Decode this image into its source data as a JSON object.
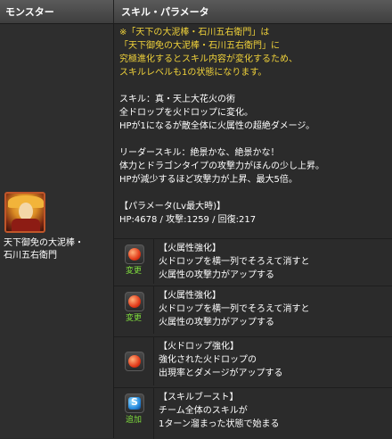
{
  "header": {
    "col_monster": "モンスター",
    "col_skill": "スキル・パラメータ"
  },
  "monster": {
    "name_line1": "天下御免の大泥棒・",
    "name_line2": "石川五右衛門",
    "avatar_icon": "monster-portrait-icon"
  },
  "note": {
    "line1": "※「天下の大泥棒・石川五右衛門」は",
    "line2": "「天下御免の大泥棒・石川五右衛門」に",
    "line3": "究極進化するとスキル内容が変化するため、",
    "line4": "スキルレベルも1の状態になります。"
  },
  "skill": {
    "line1": "スキル：真・天上大花火の術",
    "line2": "全ドロップを火ドロップに変化。",
    "line3": "HPが1になるが敵全体に火属性の超絶ダメージ。"
  },
  "leader": {
    "line1": "リーダースキル：絶景かな、絶景かな！",
    "line2": "体力とドラゴンタイプの攻撃力がほんの少し上昇。",
    "line3": "HPが減少するほど攻撃力が上昇、最大5倍。"
  },
  "params": {
    "title": "【パラメータ(Lv最大時)】",
    "values": "HP:4678 / 攻撃:1259 / 回復:217"
  },
  "awakenings": [
    {
      "tag": "変更",
      "title": "【火属性強化】",
      "line1": "火ドロップを横一列でそろえて消すと",
      "line2": "火属性の攻撃力がアップする",
      "icon": "fire-row-icon"
    },
    {
      "tag": "変更",
      "title": "【火属性強化】",
      "line1": "火ドロップを横一列でそろえて消すと",
      "line2": "火属性の攻撃力がアップする",
      "icon": "fire-row-icon"
    },
    {
      "tag": "",
      "title": "【火ドロップ強化】",
      "line1": "強化された火ドロップの",
      "line2": "出現率とダメージがアップする",
      "icon": "fire-orb-icon"
    },
    {
      "tag": "追加",
      "title": "【スキルブースト】",
      "line1": "チーム全体のスキルが",
      "line2": "1ターン溜まった状態で始まる",
      "icon": "skill-boost-icon"
    }
  ],
  "colors": {
    "note": "#f0d23a",
    "tag": "#7fdc3d",
    "bg": "#2b2b2b"
  }
}
